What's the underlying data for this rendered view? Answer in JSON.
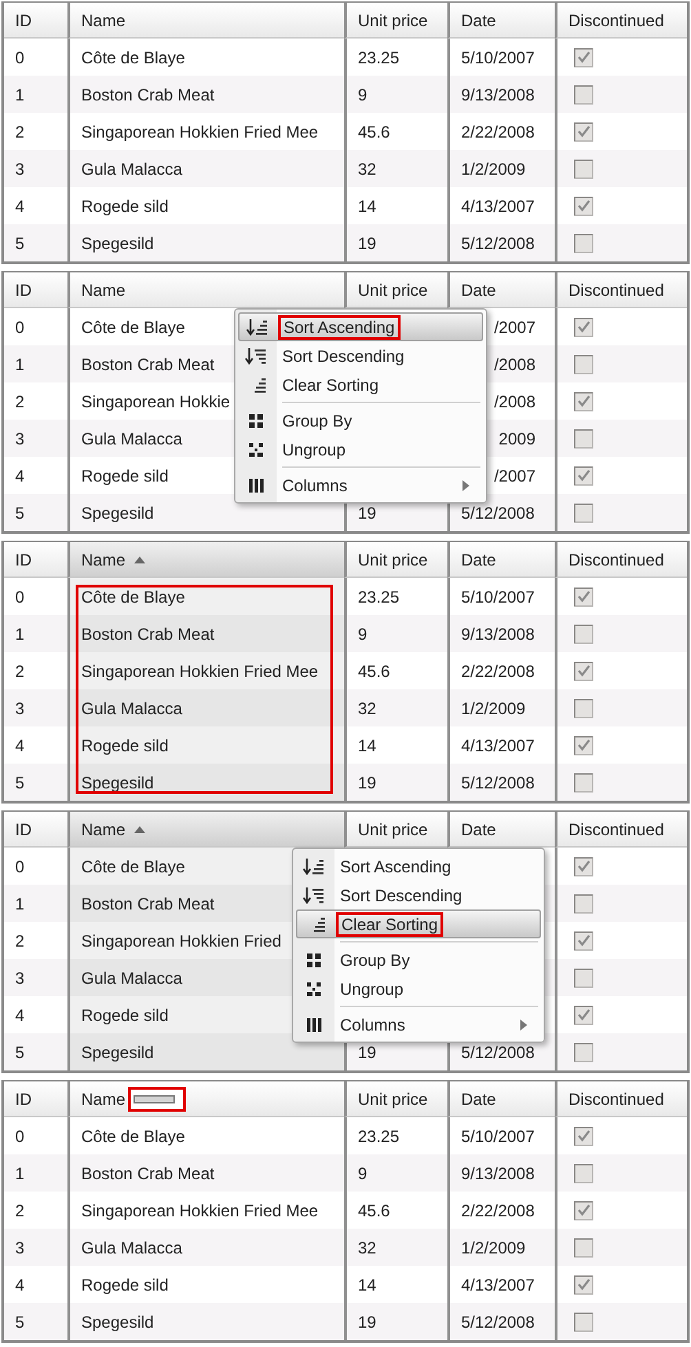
{
  "panels": [
    {
      "columns": [
        {
          "label": "ID",
          "sorted": false
        },
        {
          "label": "Name",
          "sorted": false
        },
        {
          "label": "Unit price",
          "sorted": false
        },
        {
          "label": "Date",
          "sorted": false
        },
        {
          "label": "Discontinued",
          "sorted": false
        }
      ],
      "rows": [
        {
          "id": "0",
          "name": "Côte de Blaye",
          "unit_price": "23.25",
          "date": "5/10/2007",
          "discontinued": true
        },
        {
          "id": "1",
          "name": "Boston Crab Meat",
          "unit_price": "9",
          "date": "9/13/2008",
          "discontinued": false
        },
        {
          "id": "2",
          "name": "Singaporean Hokkien Fried Mee",
          "unit_price": "45.6",
          "date": "2/22/2008",
          "discontinued": true
        },
        {
          "id": "3",
          "name": "Gula Malacca",
          "unit_price": "32",
          "date": "1/2/2009",
          "discontinued": false
        },
        {
          "id": "4",
          "name": "Rogede sild",
          "unit_price": "14",
          "date": "4/13/2007",
          "discontinued": true
        },
        {
          "id": "5",
          "name": "Spegesild",
          "unit_price": "19",
          "date": "5/12/2008",
          "discontinued": false
        }
      ]
    },
    {
      "columns": [
        {
          "label": "ID",
          "sorted": false
        },
        {
          "label": "Name",
          "sorted": false
        },
        {
          "label": "Unit price",
          "sorted": false
        },
        {
          "label": "Date",
          "sorted": false
        },
        {
          "label": "Discontinued",
          "sorted": false
        }
      ],
      "rows": [
        {
          "id": "0",
          "name": "Côte de Blaye",
          "date": "/2007",
          "partly_covered": true,
          "discontinued": true
        },
        {
          "id": "1",
          "name": "Boston Crab Meat",
          "date": "/2008",
          "partly_covered": true,
          "discontinued": false
        },
        {
          "id": "2",
          "name": "Singaporean Hokkie",
          "date": "/2008",
          "partly_covered": true,
          "discontinued": true
        },
        {
          "id": "3",
          "name": "Gula Malacca",
          "date": "2009",
          "partly_covered": true,
          "discontinued": false
        },
        {
          "id": "4",
          "name": "Rogede sild",
          "date": "/2007",
          "partly_covered": true,
          "discontinued": true
        },
        {
          "id": "5",
          "name": "Spegesild",
          "unit_price": "19",
          "date": "5/12/2008",
          "partly_covered": false,
          "discontinued": false
        }
      ],
      "menu": {
        "items": [
          {
            "kind": "sort-asc",
            "label": "Sort Ascending",
            "highlighted": true,
            "outlined": true
          },
          {
            "kind": "sort-desc",
            "label": "Sort Descending",
            "highlighted": false,
            "outlined": false
          },
          {
            "kind": "clear-sort",
            "label": "Clear Sorting",
            "highlighted": false,
            "outlined": false
          },
          {
            "kind": "group",
            "label": "Group By",
            "highlighted": false,
            "outlined": false
          },
          {
            "kind": "ungroup",
            "label": "Ungroup",
            "highlighted": false,
            "outlined": false
          },
          {
            "kind": "columns",
            "label": "Columns",
            "highlighted": false,
            "outlined": false,
            "submenu": true
          }
        ]
      }
    },
    {
      "columns": [
        {
          "label": "ID",
          "sorted": false
        },
        {
          "label": "Name",
          "sorted": true
        },
        {
          "label": "Unit price",
          "sorted": false
        },
        {
          "label": "Date",
          "sorted": false
        },
        {
          "label": "Discontinued",
          "sorted": false
        }
      ],
      "name_cells_outlined": true,
      "rows": [
        {
          "id": "0",
          "name": "Côte de Blaye",
          "unit_price": "23.25",
          "date": "5/10/2007",
          "discontinued": true
        },
        {
          "id": "1",
          "name": "Boston Crab Meat",
          "unit_price": "9",
          "date": "9/13/2008",
          "discontinued": false
        },
        {
          "id": "2",
          "name": "Singaporean Hokkien Fried Mee",
          "unit_price": "45.6",
          "date": "2/22/2008",
          "discontinued": true
        },
        {
          "id": "3",
          "name": "Gula Malacca",
          "unit_price": "32",
          "date": "1/2/2009",
          "discontinued": false
        },
        {
          "id": "4",
          "name": "Rogede sild",
          "unit_price": "14",
          "date": "4/13/2007",
          "discontinued": true
        },
        {
          "id": "5",
          "name": "Spegesild",
          "unit_price": "19",
          "date": "5/12/2008",
          "discontinued": false
        }
      ]
    },
    {
      "columns": [
        {
          "label": "ID",
          "sorted": false
        },
        {
          "label": "Name",
          "sorted": true
        },
        {
          "label": "Unit price",
          "sorted": false
        },
        {
          "label": "Date",
          "sorted": false
        },
        {
          "label": "Discontinued",
          "sorted": false
        }
      ],
      "rows": [
        {
          "id": "0",
          "name": "Côte de Blaye",
          "discontinued": true
        },
        {
          "id": "1",
          "name": "Boston Crab Meat",
          "discontinued": false
        },
        {
          "id": "2",
          "name": "Singaporean Hokkien Fried",
          "discontinued": true
        },
        {
          "id": "3",
          "name": "Gula Malacca",
          "discontinued": false
        },
        {
          "id": "4",
          "name": "Rogede sild",
          "discontinued": true
        },
        {
          "id": "5",
          "name": "Spegesild",
          "unit_price": "19",
          "date": "5/12/2008",
          "discontinued": false
        }
      ],
      "menu": {
        "items": [
          {
            "kind": "sort-asc",
            "label": "Sort Ascending",
            "highlighted": false,
            "outlined": false
          },
          {
            "kind": "sort-desc",
            "label": "Sort Descending",
            "highlighted": false,
            "outlined": false
          },
          {
            "kind": "clear-sort",
            "label": "Clear Sorting",
            "highlighted": true,
            "outlined": true
          },
          {
            "kind": "group",
            "label": "Group By",
            "highlighted": false,
            "outlined": false
          },
          {
            "kind": "ungroup",
            "label": "Ungroup",
            "highlighted": false,
            "outlined": false
          },
          {
            "kind": "columns",
            "label": "Columns",
            "highlighted": false,
            "outlined": false,
            "submenu": true
          }
        ]
      }
    },
    {
      "columns": [
        {
          "label": "ID",
          "sorted": false
        },
        {
          "label": "Name",
          "sorted": false,
          "drag_indicator": true
        },
        {
          "label": "Unit price",
          "sorted": false
        },
        {
          "label": "Date",
          "sorted": false
        },
        {
          "label": "Discontinued",
          "sorted": false
        }
      ],
      "rows": [
        {
          "id": "0",
          "name": "Côte de Blaye",
          "unit_price": "23.25",
          "date": "5/10/2007",
          "discontinued": true
        },
        {
          "id": "1",
          "name": "Boston Crab Meat",
          "unit_price": "9",
          "date": "9/13/2008",
          "discontinued": false
        },
        {
          "id": "2",
          "name": "Singaporean Hokkien Fried Mee",
          "unit_price": "45.6",
          "date": "2/22/2008",
          "discontinued": true
        },
        {
          "id": "3",
          "name": "Gula Malacca",
          "unit_price": "32",
          "date": "1/2/2009",
          "discontinued": false
        },
        {
          "id": "4",
          "name": "Rogede sild",
          "unit_price": "14",
          "date": "4/13/2007",
          "discontinued": true
        },
        {
          "id": "5",
          "name": "Spegesild",
          "unit_price": "19",
          "date": "5/12/2008",
          "discontinued": false
        }
      ]
    }
  ]
}
